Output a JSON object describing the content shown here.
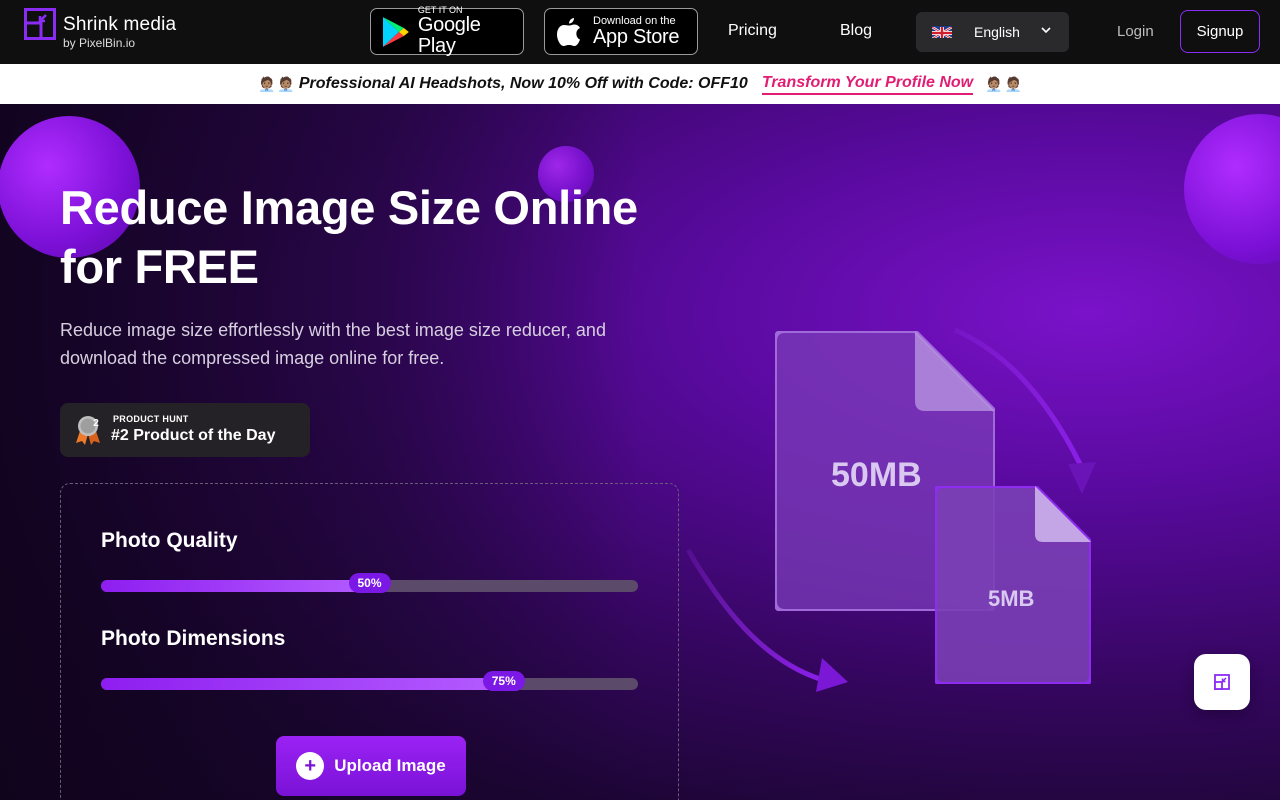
{
  "brand": {
    "title": "Shrink media",
    "subtitle": "by PixelBin.io",
    "accent": "#8b2cf5"
  },
  "nav": {
    "google_play": {
      "small": "GET IT ON",
      "big": "Google Play"
    },
    "app_store": {
      "small": "Download on the",
      "big": "App Store"
    },
    "links": [
      "Pricing",
      "Blog"
    ],
    "language": {
      "label": "English",
      "flag": "uk-flag-icon"
    },
    "login": "Login",
    "signup": "Signup"
  },
  "banner": {
    "emoji": "🧑🏽‍💼",
    "text": "Professional AI Headshots, Now 10% Off with Code: OFF10",
    "link": "Transform Your Profile Now"
  },
  "hero": {
    "title_line1": "Reduce Image Size Online",
    "title_line2": "for FREE",
    "lead_line1": "Reduce image size effortlessly with the best image size reducer, and",
    "lead_line2": "download the compressed image online for free.",
    "product_hunt": {
      "medal": "2",
      "small": "PRODUCT HUNT",
      "big": "#2 Product of the Day"
    },
    "quality": {
      "label": "Photo Quality",
      "value": 50,
      "display": "50%"
    },
    "dimensions": {
      "label": "Photo Dimensions",
      "value": 75,
      "display": "75%"
    },
    "upload": "Upload Image",
    "illustration": {
      "big_size": "50MB",
      "small_size": "5MB"
    }
  }
}
